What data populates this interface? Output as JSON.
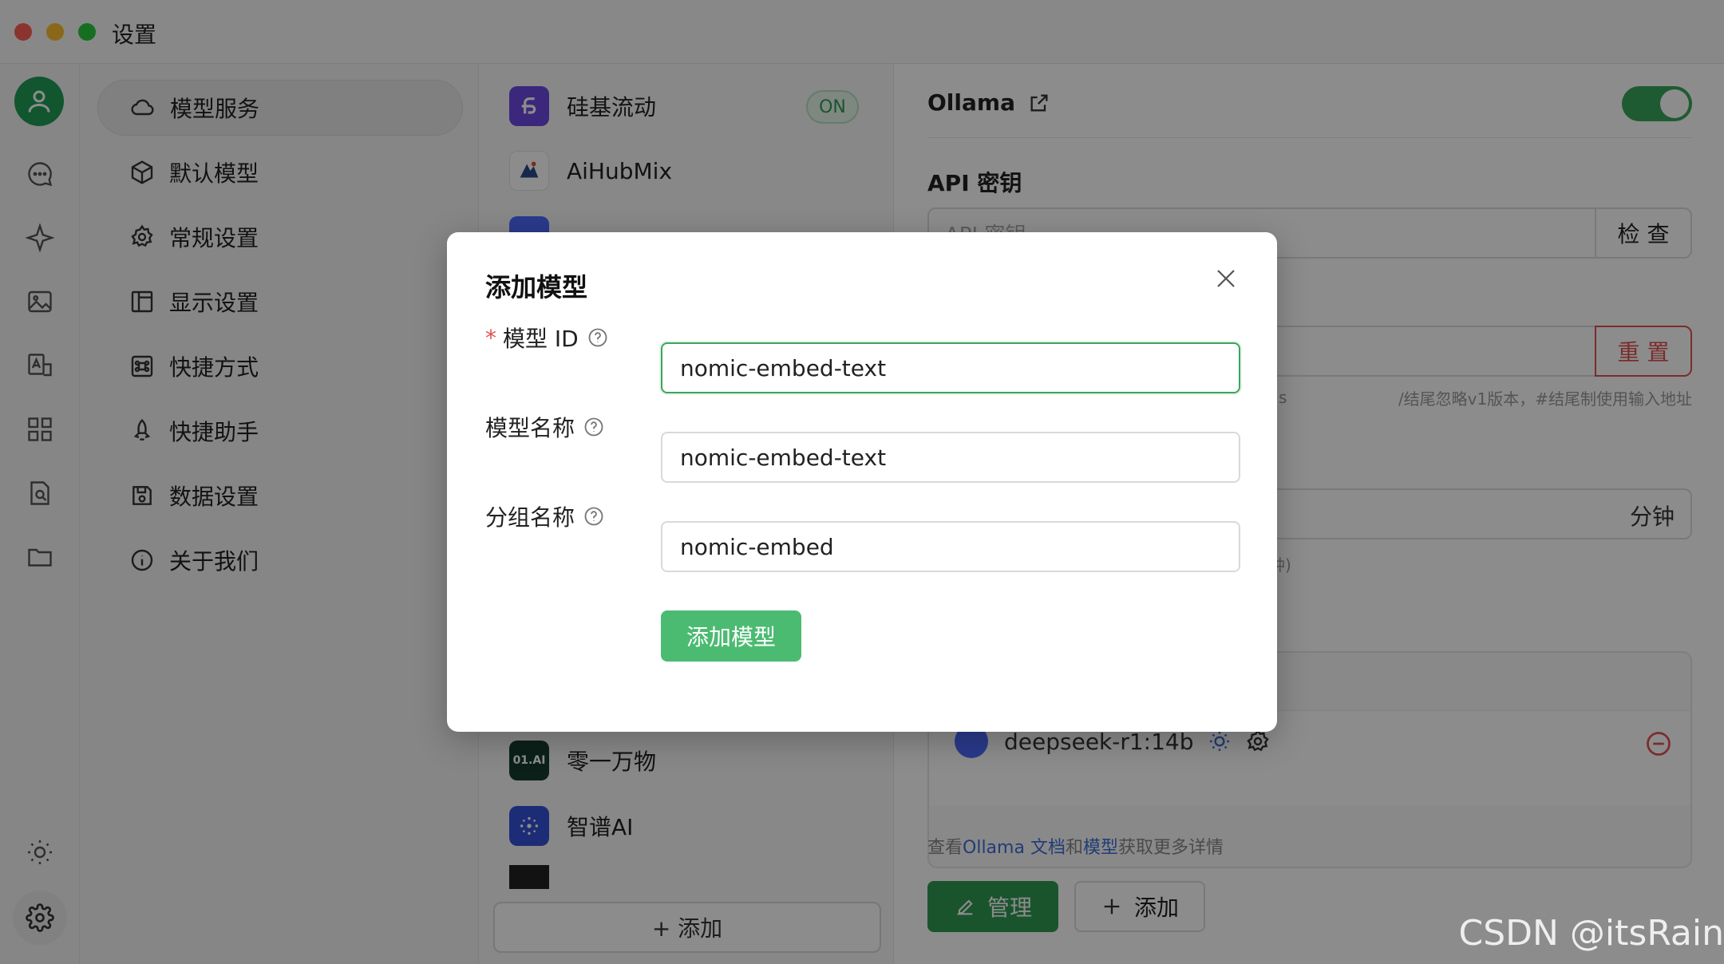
{
  "window": {
    "title": "设置"
  },
  "settings_nav": {
    "items": [
      {
        "label": "模型服务",
        "icon": "cloud-icon",
        "active": true
      },
      {
        "label": "默认模型",
        "icon": "cube-icon"
      },
      {
        "label": "常规设置",
        "icon": "gear-icon"
      },
      {
        "label": "显示设置",
        "icon": "layout-icon"
      },
      {
        "label": "快捷方式",
        "icon": "command-icon"
      },
      {
        "label": "快捷助手",
        "icon": "rocket-icon"
      },
      {
        "label": "数据设置",
        "icon": "save-icon"
      },
      {
        "label": "关于我们",
        "icon": "info-icon"
      }
    ]
  },
  "providers": {
    "items": [
      {
        "name": "硅基流动",
        "badge": "ON",
        "logo_color": "#6c48e0"
      },
      {
        "name": "AiHubMix",
        "logo_color": "#ffffff"
      },
      {
        "name": "零一万物",
        "logo_text": "01.AI",
        "logo_color": "#143b2f"
      },
      {
        "name": "智谱AI",
        "logo_color": "#3450d8"
      }
    ],
    "add_label": "+ 添加"
  },
  "detail": {
    "provider_title": "Ollama",
    "api_key_label": "API 密钥",
    "api_key_placeholder": "API 密钥",
    "check_label": "检 查",
    "reset_label": "重 置",
    "url_hint_prefix": "s",
    "url_hint": "/结尾忽略v1版本，#结尾制使用输入地址",
    "keep_alive_unit": "分钟",
    "keep_alive_hint": "钟)",
    "model_name": "deepseek-r1:14b",
    "doc_hint": {
      "prefix": "查看",
      "doc_link": "Ollama 文档",
      "mid": "和",
      "model_link": "模型",
      "suffix": "获取更多详情"
    },
    "manage_label": "管理",
    "add_label": "添加",
    "accent_color": "#2f9a52"
  },
  "modal": {
    "title": "添加模型",
    "fields": {
      "model_id": {
        "label": "模型 ID",
        "value": "nomic-embed-text",
        "required": true
      },
      "model_name": {
        "label": "模型名称",
        "value": "nomic-embed-text"
      },
      "group_name": {
        "label": "分组名称",
        "value": "nomic-embed"
      }
    },
    "submit_label": "添加模型"
  },
  "watermark": "CSDN @itsRain"
}
